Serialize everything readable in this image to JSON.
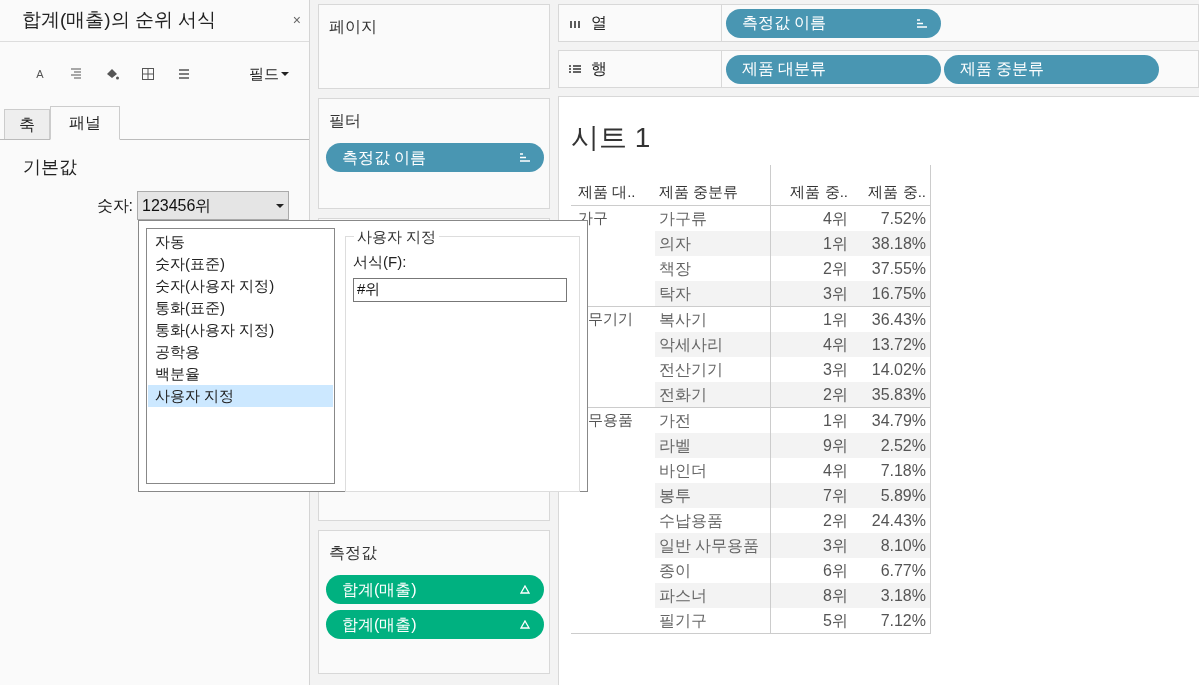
{
  "format_panel": {
    "title": "합계(매출)의 순위 서식",
    "close": "×",
    "font_button": "A",
    "fields_menu": "필드",
    "tabs": [
      {
        "label": "축",
        "selected": false
      },
      {
        "label": "패널",
        "selected": true
      }
    ],
    "section": "기본값",
    "number_label": "숫자:",
    "number_value": "123456위",
    "format_popup": {
      "categories": [
        {
          "label": "자동",
          "selected": false
        },
        {
          "label": "숫자(표준)",
          "selected": false
        },
        {
          "label": "숫자(사용자 지정)",
          "selected": false
        },
        {
          "label": "통화(표준)",
          "selected": false
        },
        {
          "label": "통화(사용자 지정)",
          "selected": false
        },
        {
          "label": "공학용",
          "selected": false
        },
        {
          "label": "백분율",
          "selected": false
        },
        {
          "label": "사용자 지정",
          "selected": true
        }
      ],
      "group_title": "사용자 지정",
      "format_label": "서식(F):",
      "format_value": "#위"
    }
  },
  "cards": {
    "pages": {
      "title": "페이지"
    },
    "filters": {
      "title": "필터",
      "pills": [
        "측정값 이름"
      ]
    },
    "measure_values": {
      "title": "측정값",
      "pills": [
        "합계(매출)",
        "합계(매출)"
      ]
    }
  },
  "shelves": [
    {
      "kind": "columns",
      "label": "열",
      "pills": [
        "측정값 이름"
      ]
    },
    {
      "kind": "rows",
      "label": "행",
      "pills": [
        "제품 대분류",
        "제품 중분류"
      ]
    }
  ],
  "sheet": {
    "title": "시트 1",
    "columns": [
      "제품 대..",
      "제품 중분류",
      "제품 중..",
      "제품 중.."
    ],
    "groups": [
      {
        "category": "가구",
        "rows": [
          [
            "가구류",
            "4위",
            "7.52%"
          ],
          [
            "의자",
            "1위",
            "38.18%"
          ],
          [
            "책장",
            "2위",
            "37.55%"
          ],
          [
            "탁자",
            "3위",
            "16.75%"
          ]
        ]
      },
      {
        "category": "무기기",
        "rows": [
          [
            "복사기",
            "1위",
            "36.43%"
          ],
          [
            "악세사리",
            "4위",
            "13.72%"
          ],
          [
            "전산기기",
            "3위",
            "14.02%"
          ],
          [
            "전화기",
            "2위",
            "35.83%"
          ]
        ]
      },
      {
        "category": "무용품",
        "rows": [
          [
            "가전",
            "1위",
            "34.79%"
          ],
          [
            "라벨",
            "9위",
            "2.52%"
          ],
          [
            "바인더",
            "4위",
            "7.18%"
          ],
          [
            "봉투",
            "7위",
            "5.89%"
          ],
          [
            "수납용품",
            "2위",
            "24.43%"
          ],
          [
            "일반 사무용품",
            "3위",
            "8.10%"
          ],
          [
            "종이",
            "6위",
            "6.77%"
          ],
          [
            "파스너",
            "8위",
            "3.18%"
          ],
          [
            "필기구",
            "5위",
            "7.12%"
          ]
        ]
      }
    ]
  }
}
